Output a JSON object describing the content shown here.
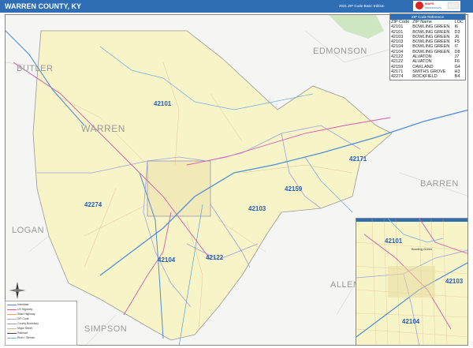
{
  "header": {
    "title": "WARREN COUNTY, KY",
    "edition": "2021 ZIP Code Basic Edition"
  },
  "map": {
    "county_name": "WARREN",
    "neighbor_counties": [
      "BUTLER",
      "EDMONSON",
      "BARREN",
      "LOGAN",
      "SIMPSON",
      "ALLEN"
    ],
    "zip_labels": [
      "42101",
      "42171",
      "42274",
      "42159",
      "42103",
      "42104",
      "42122"
    ],
    "colors": {
      "county_fill": "#f7f4c8",
      "zip_boundary": "#a0a0e0",
      "interstate": "#4f8ed8",
      "highway": "#d65ab0",
      "background": "#f5f5f3"
    }
  },
  "zip_table": {
    "header_band": "ZIP Code Reference",
    "columns": [
      "ZIP Code",
      "ZIP Name",
      "LOC"
    ],
    "rows": [
      [
        "42101",
        "BOWLING GREEN",
        "I6"
      ],
      [
        "42101",
        "BOWLING GREEN",
        "D3"
      ],
      [
        "42103",
        "BOWLING GREEN",
        "J6"
      ],
      [
        "42103",
        "BOWLING GREEN",
        "F5"
      ],
      [
        "42104",
        "BOWLING GREEN",
        "I7"
      ],
      [
        "42104",
        "BOWLING GREEN",
        "D8"
      ],
      [
        "42122",
        "ALVATON",
        "J7"
      ],
      [
        "42122",
        "ALVATON",
        "F6"
      ],
      [
        "42159",
        "OAKLAND",
        "G4"
      ],
      [
        "42171",
        "SMITHS GROVE",
        "H3"
      ],
      [
        "42274",
        "ROCKFIELD",
        "B4"
      ]
    ]
  },
  "inset": {
    "city_label": "Bowling Green",
    "zip_labels": [
      "42101",
      "42103",
      "42104"
    ]
  },
  "legend": {
    "items": [
      "Interstate",
      "US Highway",
      "State Highway",
      "ZIP Code",
      "County Boundary",
      "Major Street",
      "Railroad",
      "River / Stream"
    ]
  }
}
